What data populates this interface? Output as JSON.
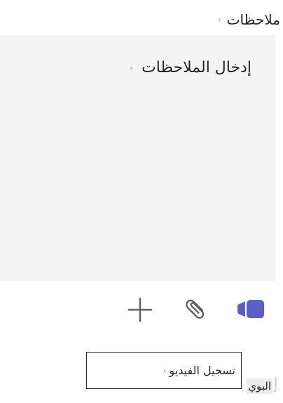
{
  "notes": {
    "label": "ملاحظات",
    "placeholder": "إدخال الملاحظات"
  },
  "toolbar": {
    "add_icon": "plus-icon",
    "attach_icon": "paperclip-icon",
    "record_icon": "video-camera-icon"
  },
  "tooltip": {
    "text": "تسجيل الفيديو"
  },
  "footer": {
    "truncated_label": "البوي"
  },
  "colors": {
    "notes_background": "#f4f4f4",
    "accent": "#5b5fc7",
    "icon_gray": "#616161",
    "text": "#242424"
  }
}
